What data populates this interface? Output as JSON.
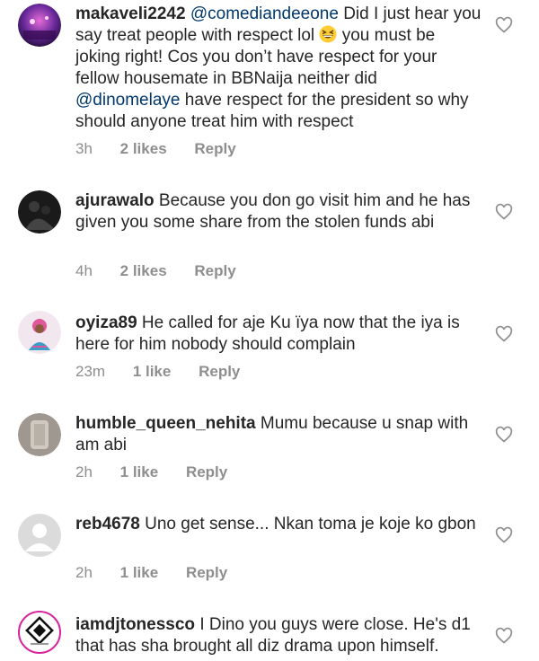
{
  "comments": [
    {
      "username": "makaveli2242",
      "mention1": "@comediandeeone",
      "text_a": " Did I just hear you say treat people with respect lol ",
      "emoji_name": "grinning-squinting-face-emoji",
      "text_b": " you must be joking right! Cos you don’t have respect for your fellow housemate in BBNaija neither did ",
      "mention2": "@dinomelaye",
      "text_c": " have respect for the president so why should anyone treat him with respect",
      "time": "3h",
      "likes": "2 likes",
      "reply": "Reply"
    },
    {
      "username": "ajurawalo",
      "text": " Because you don go visit him and he has given you some share from the stolen funds abi",
      "time": "4h",
      "likes": "2 likes",
      "reply": "Reply"
    },
    {
      "username": "oyiza89",
      "text": " He called for aje Ku ïya now that the iya is here for him nobody should complain",
      "time": "23m",
      "likes": "1 like",
      "reply": "Reply"
    },
    {
      "username": "humble_queen_nehita",
      "text": " Mumu because  u snap with am abi",
      "time": "2h",
      "likes": "1 like",
      "reply": "Reply"
    },
    {
      "username": "reb4678",
      "text": " Uno get sense... Nkan toma je koje ko gbon",
      "time": "2h",
      "likes": "1 like",
      "reply": "Reply"
    },
    {
      "username": "iamdjtonessco",
      "text": " I Dino you guys were close. He's d1 that has sha brought all diz drama upon himself."
    }
  ],
  "icons": {
    "like": "heart-outline-icon",
    "avatar_placeholder": "default-avatar-icon"
  },
  "colors": {
    "mention": "#00376b",
    "meta": "#8e8e8e",
    "text": "#262626"
  }
}
